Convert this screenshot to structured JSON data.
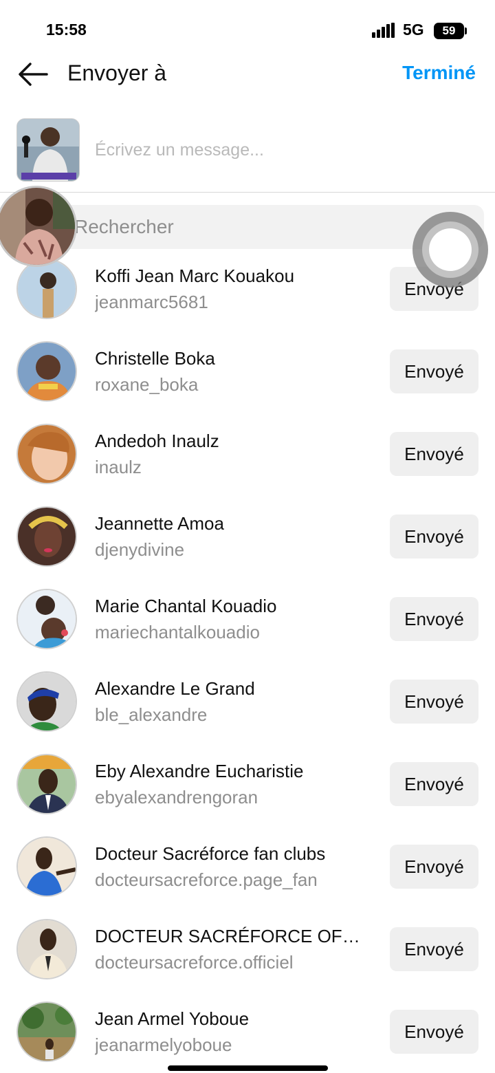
{
  "status_bar": {
    "time": "15:58",
    "network": "5G",
    "battery": "59"
  },
  "header": {
    "title": "Envoyer à",
    "done_label": "Terminé",
    "back_icon": "arrow-left-icon"
  },
  "message": {
    "placeholder": "Écrivez un message..."
  },
  "search": {
    "placeholder": "Rechercher"
  },
  "colors": {
    "accent": "#0095f6",
    "secondary_text": "#8e8e8e",
    "button_bg": "#efefef"
  },
  "contacts": [
    {
      "name": "Koffi Jean Marc Kouakou",
      "username": "jeanmarc5681",
      "button": "Envoyé"
    },
    {
      "name": "Christelle Boka",
      "username": "roxane_boka",
      "button": "Envoyé"
    },
    {
      "name": "Andedoh Inaulz",
      "username": "inaulz",
      "button": "Envoyé"
    },
    {
      "name": "Jeannette Amoa",
      "username": "djenydivine",
      "button": "Envoyé"
    },
    {
      "name": "Marie Chantal Kouadio",
      "username": "mariechantalkouadio",
      "button": "Envoyé"
    },
    {
      "name": "Alexandre Le Grand",
      "username": "ble_alexandre",
      "button": "Envoyé"
    },
    {
      "name": "Eby Alexandre Eucharistie",
      "username": "ebyalexandrengoran",
      "button": "Envoyé"
    },
    {
      "name": "Docteur Sacréforce fan clubs",
      "username": "docteursacreforce.page_fan",
      "button": "Envoyé"
    },
    {
      "name": "DOCTEUR SACRÉFORCE OFFICIEL",
      "username": "docteursacreforce.officiel",
      "button": "Envoyé"
    },
    {
      "name": "Jean Armel Yoboue",
      "username": "jeanarmelyoboue",
      "button": "Envoyé"
    }
  ]
}
